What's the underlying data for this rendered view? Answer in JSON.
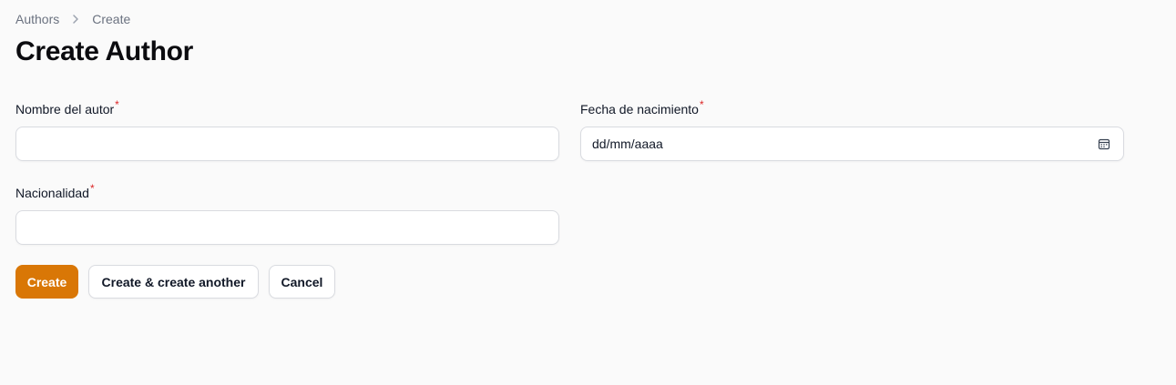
{
  "breadcrumb": {
    "items": [
      "Authors",
      "Create"
    ]
  },
  "page": {
    "title": "Create Author"
  },
  "form": {
    "nombre": {
      "label": "Nombre del autor",
      "required_mark": "*",
      "value": "",
      "placeholder": ""
    },
    "fecha": {
      "label": "Fecha de nacimiento",
      "required_mark": "*",
      "value": "",
      "placeholder": "dd/mm/aaaa",
      "icon": "calendar-icon"
    },
    "nacionalidad": {
      "label": "Nacionalidad",
      "required_mark": "*",
      "value": "",
      "placeholder": ""
    }
  },
  "actions": {
    "create_label": "Create",
    "create_another_label": "Create & create another",
    "cancel_label": "Cancel"
  },
  "colors": {
    "accent": "#d97706",
    "required": "#dc2626",
    "background": "#fafafa"
  }
}
